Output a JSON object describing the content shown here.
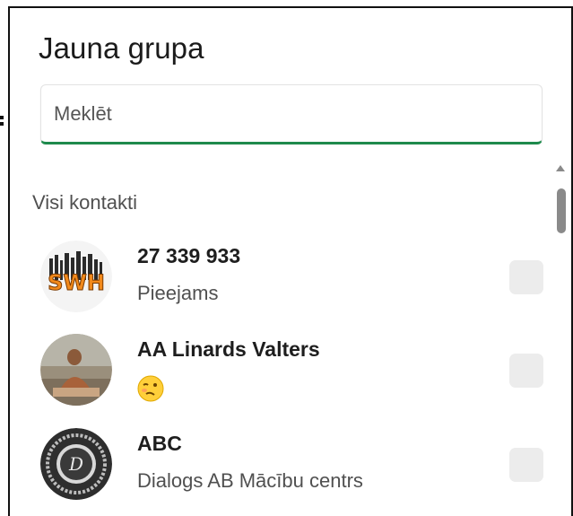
{
  "dialog": {
    "title": "Jauna grupa",
    "search_placeholder": "Meklēt",
    "search_value": "",
    "section_label": "Visi kontakti"
  },
  "contacts": [
    {
      "name": "27 339 933",
      "status": "Pieejams",
      "avatar": "swh-logo-avatar",
      "checked": false
    },
    {
      "name": "AA Linards Valters",
      "status": "",
      "status_icon": "woozy-face-emoji",
      "avatar": "photo-avatar",
      "checked": false
    },
    {
      "name": "ABC",
      "status": "Dialogs AB Mācību centrs",
      "avatar": "dialogs-logo-avatar",
      "checked": false
    }
  ],
  "colors": {
    "accent": "#1e8a4c",
    "checkbox": "#ececec"
  }
}
